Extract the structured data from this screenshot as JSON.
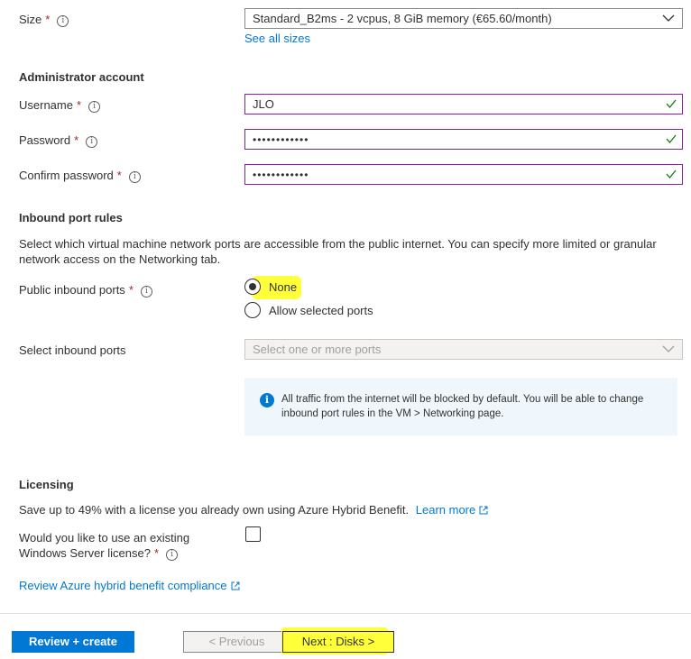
{
  "size": {
    "label": "Size",
    "required_mark": "*",
    "value": "Standard_B2ms - 2 vcpus, 8 GiB memory (€65.60/month)",
    "see_all_link": "See all sizes"
  },
  "admin": {
    "section_title": "Administrator account",
    "username_label": "Username",
    "username_value": "JLO",
    "password_label": "Password",
    "password_value": "••••••••••••",
    "confirm_label": "Confirm password",
    "confirm_value": "••••••••••••",
    "required_mark": "*"
  },
  "inbound": {
    "section_title": "Inbound port rules",
    "description": "Select which virtual machine network ports are accessible from the public internet. You can specify more limited or granular network access on the Networking tab.",
    "public_label": "Public inbound ports",
    "required_mark": "*",
    "options": [
      {
        "label": "None",
        "selected": true
      },
      {
        "label": "Allow selected ports",
        "selected": false
      }
    ],
    "select_label": "Select inbound ports",
    "select_placeholder": "Select one or more ports",
    "info_text": "All traffic from the internet will be blocked by default. You will be able to change inbound port rules in the VM > Networking page."
  },
  "licensing": {
    "section_title": "Licensing",
    "description": "Save up to 49% with a license you already own using Azure Hybrid Benefit.",
    "learn_more": "Learn more",
    "question_line1": "Would you like to use an existing",
    "question_line2": "Windows Server license?",
    "required_mark": "*",
    "review_link": "Review Azure hybrid benefit compliance"
  },
  "footer": {
    "review_create": "Review + create",
    "previous": "< Previous",
    "next": "Next : Disks >"
  },
  "colors": {
    "accent": "#0078d4",
    "highlight": "#ffff3a",
    "valid_border": "#8a1e9e",
    "check": "#107c10"
  }
}
